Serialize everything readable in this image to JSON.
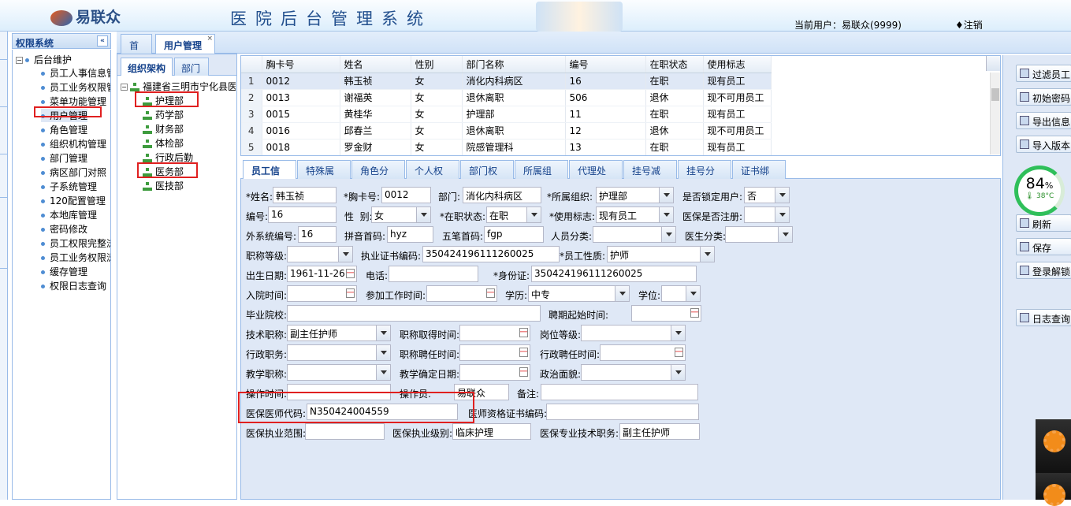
{
  "header": {
    "logo_text": "易联众",
    "system_title": "医院后台管理系统",
    "current_user": "当前用户：易联众(9999)",
    "logout": "♦注销"
  },
  "left_panel": {
    "title": "权限系统",
    "collapse": "«",
    "root": "后台维护",
    "items": [
      "员工人事信息管",
      "员工业务权限管",
      "菜单功能管理",
      "用户管理",
      "角色管理",
      "组织机构管理",
      "部门管理",
      "病区部门对照",
      "子系统管理",
      "120配置管理",
      "本地库管理",
      "密码修改",
      "员工权限完整浏",
      "员工业务权限浏",
      "缓存管理",
      "权限日志查询"
    ]
  },
  "tabs": {
    "home": "首页",
    "user_mgmt": "用户管理",
    "close": "×"
  },
  "org_panel": {
    "tab_org": "组织架构",
    "tab_dept": "部门",
    "root": "福建省三明市宁化县医",
    "depts": [
      "护理部",
      "药学部",
      "财务部",
      "体检部",
      "行政后勤",
      "医务部",
      "医技部"
    ]
  },
  "grid": {
    "columns": [
      "胸卡号",
      "姓名",
      "性别",
      "部门名称",
      "编号",
      "在职状态",
      "使用标志"
    ],
    "rows": [
      [
        "1",
        "0012",
        "韩玉祯",
        "女",
        "消化内科病区",
        "16",
        "在职",
        "现有员工"
      ],
      [
        "2",
        "0013",
        "谢福英",
        "女",
        "退休离职",
        "506",
        "退休",
        "现不可用员工"
      ],
      [
        "3",
        "0015",
        "黄桂华",
        "女",
        "护理部",
        "11",
        "在职",
        "现有员工"
      ],
      [
        "4",
        "0016",
        "邱春兰",
        "女",
        "退休离职",
        "12",
        "退休",
        "现不可用员工"
      ],
      [
        "5",
        "0018",
        "罗金财",
        "女",
        "院感管理科",
        "13",
        "在职",
        "现有员工"
      ]
    ]
  },
  "form_tabs": [
    "员工信息",
    "特殊属性",
    "角色分发",
    "个人权限",
    "部门权限",
    "所属组织",
    "代理处方",
    "挂号减免",
    "挂号分发",
    "证书绑定"
  ],
  "form": {
    "name_label": "*姓名:",
    "name": "韩玉祯",
    "card_label": "*胸卡号:",
    "card": "0012",
    "dept_label": "部门:",
    "dept": "消化内科病区",
    "org_label": "*所属组织:",
    "org": "护理部",
    "lock_label": "是否锁定用户:",
    "lock": "否",
    "code_label": "编号:",
    "code": "16",
    "sex_label": "性  别:",
    "sex": "女",
    "status_label": "*在职状态:",
    "status": "在职",
    "flag_label": "*使用标志:",
    "flag": "现有员工",
    "insured_label": "医保是否注册:",
    "insured": "",
    "ext_label": "外系统编号:",
    "ext": "16",
    "pinyin_label": "拼音首码:",
    "pinyin": "hyz",
    "wubi_label": "五笔首码:",
    "wubi": "fgp",
    "pcat_label": "人员分类:",
    "pcat": "",
    "dcat_label": "医生分类:",
    "dcat": "",
    "rank_label": "职称等级:",
    "rank": "",
    "license_label": "执业证书编码:",
    "license": "350424196111260025",
    "nature_label": "*员工性质:",
    "nature": "护师",
    "birth_label": "出生日期:",
    "birth": "1961-11-26",
    "phone_label": "电话:",
    "phone": "",
    "id_label": "*身份证:",
    "id": "350424196111260025",
    "entry_label": "入院时间:",
    "entry": "",
    "work_label": "参加工作时间:",
    "work": "",
    "edu_label": "学历:",
    "edu": "中专",
    "degree_label": "学位:",
    "degree": "",
    "school_label": "毕业院校:",
    "school": "",
    "hire_label": "聘期起始时间:",
    "hire": "",
    "tech_label": "技术职称:",
    "tech": "副主任护师",
    "techdate_label": "职称取得时间:",
    "techdate": "",
    "post_label": "岗位等级:",
    "post": "",
    "admin_label": "行政职务:",
    "admin": "",
    "techhire_label": "职称聘任时间:",
    "techhire": "",
    "adminhire_label": "行政聘任时间:",
    "adminhire": "",
    "teach_label": "教学职称:",
    "teach": "",
    "teachdate_label": "教学确定日期:",
    "teachdate": "",
    "politic_label": "政治面貌:",
    "politic": "",
    "optime_label": "操作时间:",
    "optime": "",
    "operator_label": "操作员:",
    "operator": "易联众",
    "remark_label": "备注:",
    "remark": "",
    "doccode_label": "医保医师代码:",
    "doccode": "N350424004559",
    "cert_label": "医师资格证书编码:",
    "cert": "",
    "scope_label": "医保执业范围:",
    "scope": "",
    "level_label": "医保执业级别:",
    "level": "临床护理",
    "title_label": "医保专业技术职务:",
    "title": "副主任护师"
  },
  "toolbar": {
    "filter": "过滤员工",
    "init_pwd": "初始密码",
    "export": "导出信息",
    "import": "导入版本",
    "refresh": "刷新",
    "save": "保存",
    "unlock": "登录解锁",
    "log": "日志查询"
  },
  "gauge": {
    "percent": "84",
    "unit": "%",
    "temp": "🌡 38°C"
  },
  "colors": {
    "panel_blue": "#dfe8f6",
    "border_blue": "#99bbe8",
    "highlight_red": "#e02020"
  }
}
